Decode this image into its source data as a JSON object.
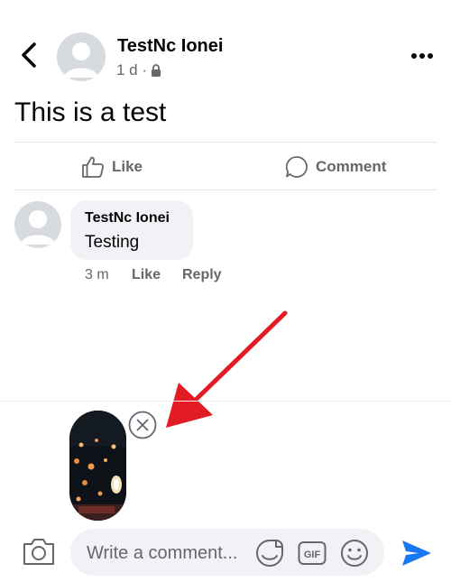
{
  "post": {
    "author": "TestNc Ionei",
    "age": "1 d ·",
    "text": "This is a test"
  },
  "actions": {
    "like": "Like",
    "comment": "Comment"
  },
  "comment": {
    "author": "TestNc Ionei",
    "text": "Testing",
    "time": "3 m",
    "like": "Like",
    "reply": "Reply"
  },
  "composer": {
    "placeholder": "Write a comment...",
    "gif_label": "GIF"
  },
  "colors": {
    "accent": "#1877f2",
    "annotation_arrow": "#e31b23"
  }
}
